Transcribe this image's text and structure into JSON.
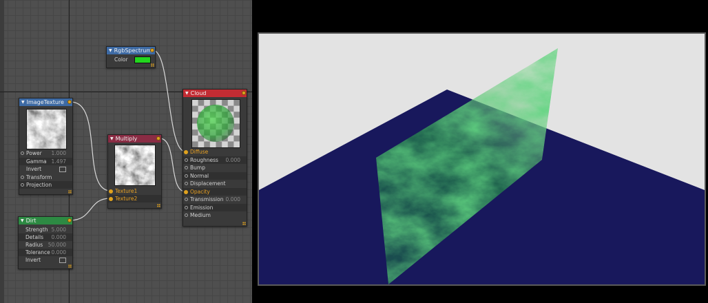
{
  "nodes": {
    "rgbspectrum": {
      "title": "RgbSpectrum",
      "color_label": "Color",
      "swatch": "#22d61e"
    },
    "imagetexture": {
      "title": "ImageTexture",
      "params": [
        {
          "label": "Power",
          "value": "1.000"
        },
        {
          "label": "Gamma",
          "value": "1.497"
        },
        {
          "label": "Invert",
          "value": ""
        },
        {
          "label": "Transform",
          "value": ""
        },
        {
          "label": "Projection",
          "value": ""
        }
      ]
    },
    "multiply": {
      "title": "Multiply",
      "inputs": [
        "Texture1",
        "Texture2"
      ]
    },
    "cloud": {
      "title": "Cloud",
      "params": [
        {
          "label": "Diffuse",
          "value": ""
        },
        {
          "label": "Roughness",
          "value": "0.000"
        },
        {
          "label": "Bump",
          "value": ""
        },
        {
          "label": "Normal",
          "value": ""
        },
        {
          "label": "Displacement",
          "value": ""
        },
        {
          "label": "Opacity",
          "value": ""
        },
        {
          "label": "Transmission",
          "value": "0.000"
        },
        {
          "label": "Emission",
          "value": ""
        },
        {
          "label": "Medium",
          "value": ""
        }
      ]
    },
    "dirt": {
      "title": "Dirt",
      "params": [
        {
          "label": "Strength",
          "value": "5.000"
        },
        {
          "label": "Details",
          "value": "0.000"
        },
        {
          "label": "Radius",
          "value": "50.000"
        },
        {
          "label": "Tolerance",
          "value": "0.000"
        },
        {
          "label": "Invert",
          "value": ""
        }
      ]
    }
  },
  "colors": {
    "editor_bg": "#4f4f4f",
    "port_orange": "#e0a21e",
    "link": "#d9d9d9",
    "render_sky": "#e3e3e3",
    "render_ground": "#18185c",
    "render_plane": "#1fa13a"
  }
}
